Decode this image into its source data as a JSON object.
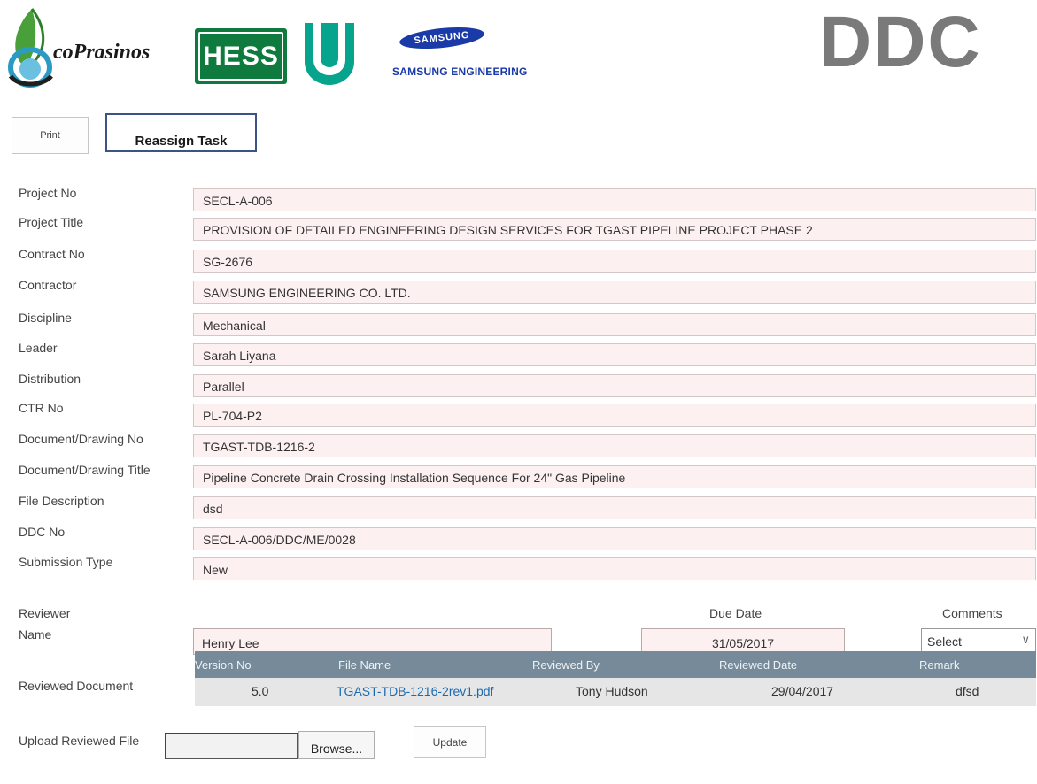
{
  "logos": {
    "ecoprasinos": "coPrasinos",
    "hess": "HESS",
    "samsung_oval": "SAMSUNG",
    "samsung_name": "SAMSUNG ENGINEERING",
    "ddc": "DDC",
    "colors": {
      "hess_green": "#0f7a3d",
      "petronas_green": "#06a48c",
      "samsung_blue": "#1a3aa8",
      "ddc_gray": "#7a7a7a"
    }
  },
  "actions": {
    "print_label": "Print",
    "reassign_label": "Reassign Task"
  },
  "fields": [
    {
      "label": "Project No",
      "value": "SECL-A-006"
    },
    {
      "label": "Project Title",
      "value": "PROVISION OF DETAILED ENGINEERING DESIGN SERVICES FOR TGAST PIPELINE PROJECT PHASE 2"
    },
    {
      "label": "Contract No",
      "value": "SG-2676"
    },
    {
      "label": "Contractor",
      "value": "SAMSUNG ENGINEERING CO. LTD."
    },
    {
      "label": "Discipline",
      "value": "Mechanical"
    },
    {
      "label": "Leader",
      "value": "Sarah Liyana"
    },
    {
      "label": "Distribution",
      "value": "Parallel"
    },
    {
      "label": "CTR No",
      "value": "PL-704-P2"
    },
    {
      "label": "Document/Drawing No",
      "value": "TGAST-TDB-1216-2"
    },
    {
      "label": "Document/Drawing Title",
      "value": "Pipeline Concrete Drain Crossing Installation Sequence For 24\" Gas Pipeline"
    },
    {
      "label": "File Description",
      "value": "dsd"
    },
    {
      "label": "DDC No",
      "value": "SECL-A-006/DDC/ME/0028"
    },
    {
      "label": "Submission Type",
      "value": "New"
    }
  ],
  "reviewer": {
    "reviewer_label": "Reviewer",
    "name_label": "Name",
    "name_value": "Henry Lee",
    "due_date_label": "Due Date",
    "due_date_value": "31/05/2017",
    "comments_label": "Comments",
    "comments_selected": "Select"
  },
  "reviewed_document": {
    "label": "Reviewed Document",
    "columns": [
      "Version No",
      "File Name",
      "Reviewed By",
      "Reviewed Date",
      "Remark"
    ],
    "rows": [
      {
        "version": "5.0",
        "file_name": "TGAST-TDB-1216-2rev1.pdf",
        "reviewed_by": "Tony Hudson",
        "reviewed_date": "29/04/2017",
        "remark": "dfsd"
      }
    ]
  },
  "upload": {
    "label": "Upload Reviewed File",
    "browse_label": "Browse...",
    "update_label": "Update"
  }
}
